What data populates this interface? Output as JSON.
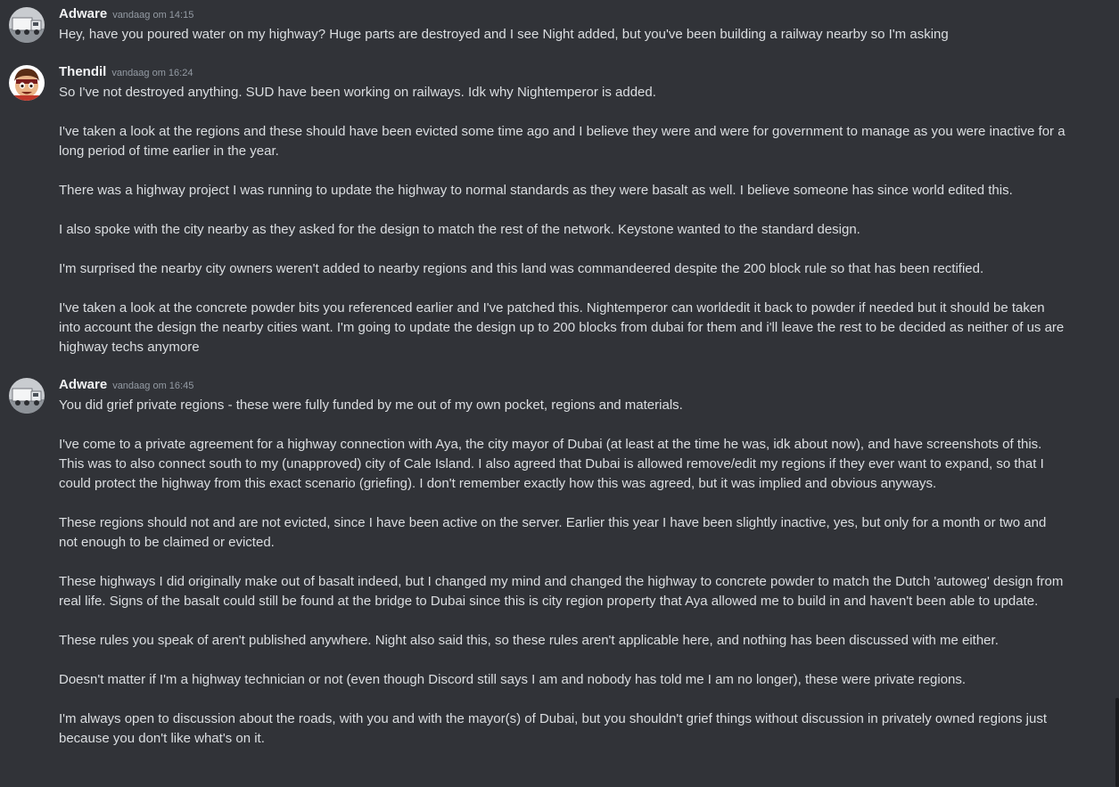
{
  "messages": [
    {
      "author": "Adware",
      "timestamp": "vandaag om 14:15",
      "avatar": "truck-avatar-icon",
      "paragraphs": [
        "Hey, have you poured water on my highway? Huge parts are destroyed and I see Night added, but you've been building a railway nearby so I'm asking"
      ]
    },
    {
      "author": "Thendil",
      "timestamp": "vandaag om 16:24",
      "avatar": "cartoon-face-avatar-icon",
      "paragraphs": [
        "So I've not destroyed anything. SUD have been working on railways. Idk why Nightemperor is added.",
        "I've taken a look at the regions and these should have been evicted some time ago and I believe they were and were for government to manage as you were inactive for a long period of time earlier in the year.",
        "There was a highway project I was running to update the highway to normal standards as they were basalt as well. I believe someone has since world edited this.",
        "I also spoke with the city nearby as they asked for the design to match the rest of the network. Keystone wanted to the standard design.",
        "I'm surprised the nearby city owners weren't added to nearby regions and this land was commandeered despite the 200 block rule so that has been rectified.",
        "I've taken a look at the concrete powder bits you referenced earlier and I've patched this. Nightemperor can worldedit it back to powder if needed but it should be taken into account the design the nearby cities want. I'm going to update the design up to 200 blocks from dubai for them and i'll leave the rest to be decided as neither of us are highway techs anymore"
      ]
    },
    {
      "author": "Adware",
      "timestamp": "vandaag om 16:45",
      "avatar": "truck-avatar-icon",
      "paragraphs": [
        "You did grief private regions - these were fully funded by me out of my own pocket, regions and materials.",
        "I've come to a private agreement for a highway connection with Aya, the city mayor of Dubai (at least at the time he was, idk about now), and have screenshots of this. This was to also connect south to my (unapproved) city of Cale Island. I also agreed that Dubai is allowed remove/edit my regions if they ever want to expand, so that I could protect the highway from this exact scenario (griefing). I don't remember exactly how this was agreed, but it was implied and obvious anyways.",
        "These regions should not and are not evicted, since I have been active on the server. Earlier this year I have been slightly inactive, yes, but only for a month or two and not enough to be claimed or evicted.",
        "These highways I did originally make out of basalt indeed, but I changed my mind and changed the highway to concrete powder to match the Dutch 'autoweg' design from real life. Signs of the basalt could still be found at the bridge to Dubai since this is city region property that Aya allowed me to build in and haven't been able to update.",
        "These rules you speak of aren't published anywhere. Night also said this, so these rules aren't applicable here, and nothing has been discussed with me either.",
        "Doesn't matter if I'm a highway technician or not (even though Discord still says I am and nobody has told me I am no longer), these were private regions.",
        "I'm always open to discussion about the roads, with you and with the mayor(s) of Dubai, but you shouldn't grief things without discussion in privately owned regions just because you don't like what's on it."
      ]
    }
  ],
  "colors": {
    "background": "#313338",
    "text": "#dbdee1",
    "username": "#f2f3f5",
    "timestamp": "#949ba4"
  }
}
